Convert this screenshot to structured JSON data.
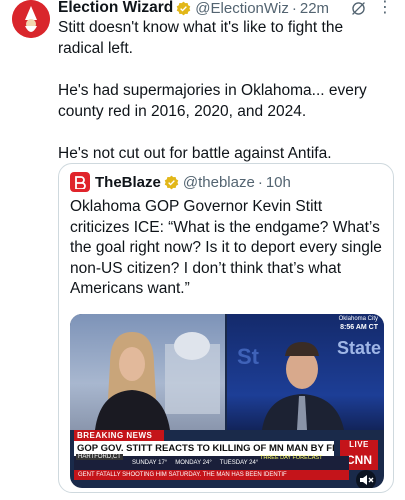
{
  "post": {
    "author_name": "Election Wizard",
    "author_handle": "@ElectionWiz",
    "separator": "·",
    "time": "22m",
    "more": "⋮",
    "paragraphs": [
      "Stitt doesn't know what it's like to fight the radical left.",
      "He's had supermajories in Oklahoma... every county red in 2016, 2020, and 2024.",
      "He's not cut out for battle against Antifa."
    ]
  },
  "quote": {
    "author_name": "TheBlaze",
    "author_handle": "@theblaze",
    "separator": "·",
    "time": "10h",
    "text": "Oklahoma GOP Governor Kevin Stitt criticizes ICE: “What is the endgame? What’s the goal right now? Is it to deport every single non-US citizen? I don’t think that’s what Americans want.”"
  },
  "video": {
    "location": "Oklahoma City",
    "clock": "8:56 AM CT",
    "breaking": "BREAKING NEWS",
    "live": "LIVE",
    "headline": "GOP GOV. STITT REACTS TO KILLING OF MN MAN BY FEDERAL AGENTS",
    "network": "CNN",
    "affiliate": "HARTFORD,CT",
    "forecast_label": "THREE DAY FORECAST",
    "weather": [
      "SUNDAY 17°",
      "MONDAY 24°",
      "TUESDAY 24°"
    ],
    "ticker": "GENT FATALLY SHOOTING HIM SATURDAY. THE MAN HAS BEEN IDENTIF"
  },
  "colors": {
    "verified_gold": "#e2b719",
    "brand_red": "#e0242b",
    "muted_text": "#536471"
  }
}
